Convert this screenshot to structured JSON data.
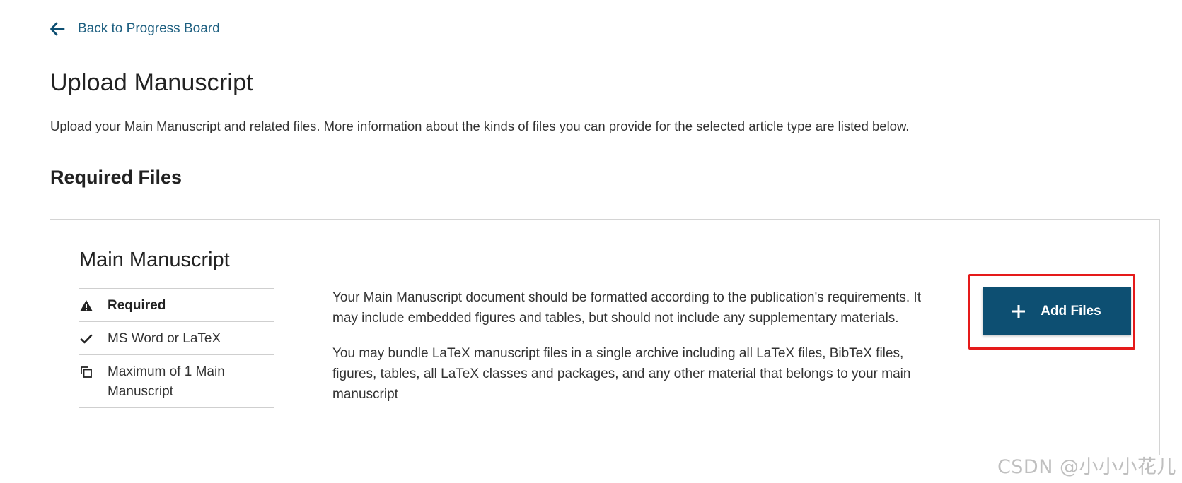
{
  "nav": {
    "back_label": "Back to Progress Board",
    "back_icon": "arrow-left-icon"
  },
  "page": {
    "title": "Upload Manuscript",
    "intro": "Upload your Main Manuscript and related files. More information about the kinds of files you can provide for the selected article type are listed below."
  },
  "required_section": {
    "title": "Required Files",
    "card": {
      "title": "Main Manuscript",
      "meta": [
        {
          "icon": "warning-icon",
          "label": "Required"
        },
        {
          "icon": "check-icon",
          "label": "MS Word or LaTeX"
        },
        {
          "icon": "copy-icon",
          "label": "Maximum of 1 Main Manuscript"
        }
      ],
      "description": [
        "Your Main Manuscript document should be formatted according to the publication's requirements. It may include embedded figures and tables, but should not include any supplementary materials.",
        "You may bundle LaTeX manuscript files in a single archive including all LaTeX files, BibTeX files, figures, tables, all LaTeX classes and packages, and any other material that belongs to your main manuscript"
      ],
      "add_button_label": "Add Files",
      "add_button_icon": "plus-icon"
    }
  },
  "watermark": "CSDN @小小小花儿",
  "colors": {
    "link": "#1d5f80",
    "button_bg": "#0d4f72",
    "highlight": "#e51a1a",
    "border": "#d4d4d4"
  }
}
